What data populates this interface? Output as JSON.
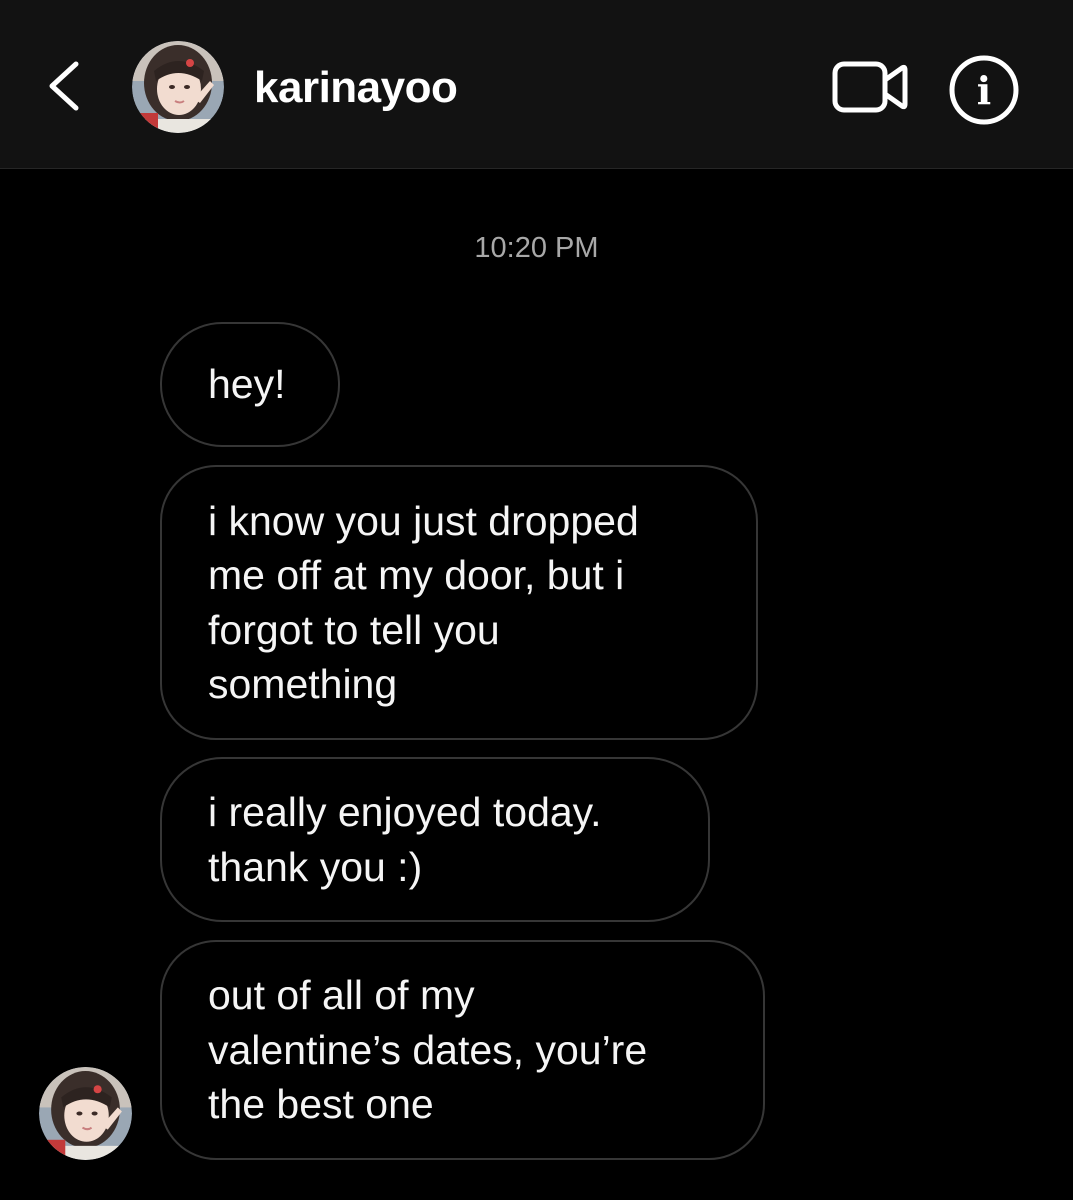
{
  "header": {
    "username": "karinayoo",
    "back_icon": "chevron-left-icon",
    "video_icon": "video-camera-icon",
    "info_icon": "info-icon",
    "info_glyph": "i"
  },
  "thread": {
    "timestamp": "10:20 PM",
    "messages": [
      {
        "text": "hey!"
      },
      {
        "text": "i know you just dropped\nme off at my door, but i\nforgot to tell you\nsomething"
      },
      {
        "text": "i really enjoyed today.\nthank you :)"
      },
      {
        "text": "out of all of my\nvalentine’s dates, you’re\nthe best one"
      }
    ]
  },
  "colors": {
    "background": "#000000",
    "header_background": "#121212",
    "bubble_border": "#363636",
    "timestamp": "#a8a8a8",
    "text": "#ffffff"
  }
}
